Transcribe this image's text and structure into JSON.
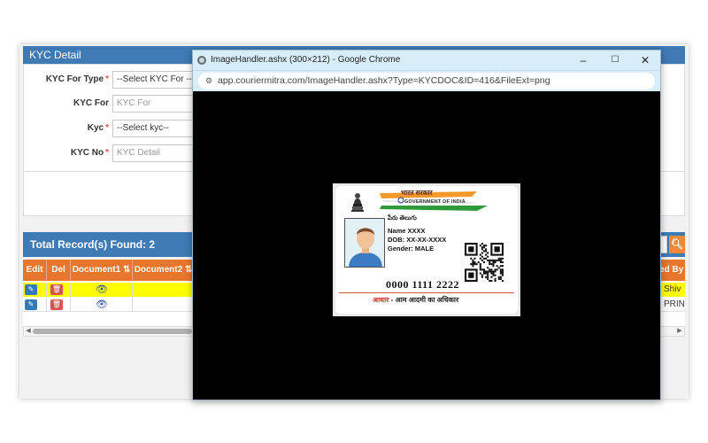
{
  "app": {
    "kyc_header": "KYC Detail",
    "form": {
      "kyc_for_type": {
        "label": "KYC For Type",
        "value": "--Select KYC For --"
      },
      "kyc_for": {
        "label": "KYC For",
        "placeholder": "KYC For"
      },
      "kyc": {
        "label": "Kyc",
        "value": "--Select kyc--"
      },
      "kyc_no": {
        "label": "KYC No",
        "placeholder": "KYC Detail"
      },
      "required_mark": "*"
    },
    "records_title": "Total Record(s) Found: 2",
    "table": {
      "headers": [
        "Edit",
        "Del",
        "Document1 ⇅",
        "Document2 ⇅",
        "ted By"
      ],
      "rows": [
        {
          "last_col": "Shiv I",
          "highlight": "#ffff00"
        },
        {
          "last_col": "PRIN",
          "highlight": "#ffffff"
        }
      ]
    },
    "colors": {
      "header_blue": "#3f7ab5",
      "table_orange": "#e8762c",
      "search_orange": "#f0883a"
    },
    "icons": {
      "edit": "pencil-icon",
      "delete": "trash-icon",
      "view": "eye-icon",
      "search": "search-icon"
    }
  },
  "popup": {
    "title": "ImageHandler.ashx (300×212) - Google Chrome",
    "url": "app.couriermitra.com/ImageHandler.ashx?Type=KYCDOC&ID=416&FileExt=png",
    "controls": {
      "minimize": "–",
      "maximize": "☐",
      "close": "✕"
    }
  },
  "card": {
    "gov_hindi": "भारत सरकार",
    "gov_english": "GOVERNMENT OF INDIA",
    "regional_name": "పేరు తెలుగు",
    "name": "Name XXXX",
    "dob": "DOB: XX-XX-XXXX",
    "gender": "Gender: MALE",
    "number": "0000 1111 2222",
    "slogan_red": "आधार",
    "slogan_rest": " - आम आदमी का अधिकार"
  }
}
